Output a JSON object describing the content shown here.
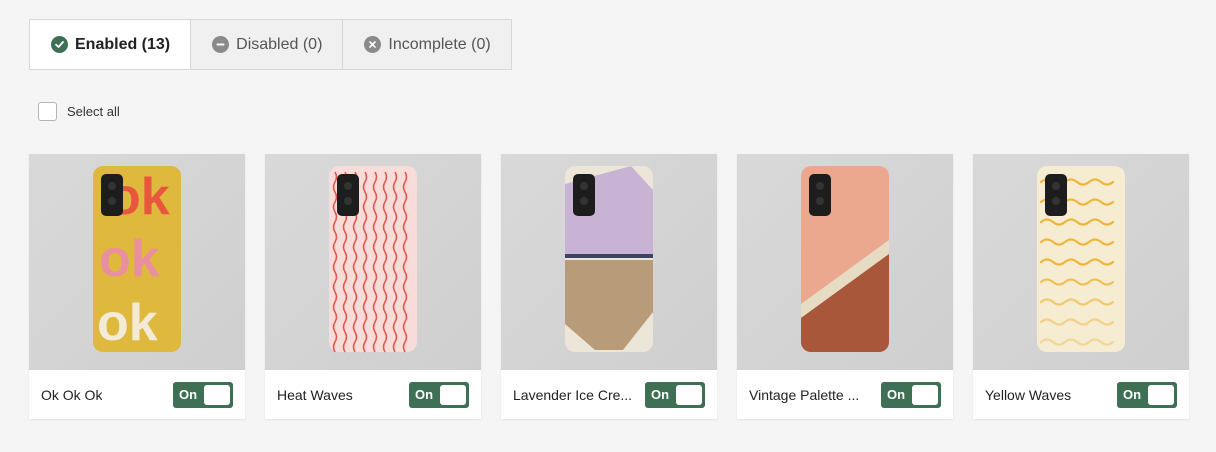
{
  "tabs": [
    {
      "label": "Enabled (13)",
      "icon": "check-circle-icon",
      "color": "#3e7055",
      "active": true
    },
    {
      "label": "Disabled (0)",
      "icon": "minus-circle-icon",
      "color": "#8a8a8a",
      "active": false
    },
    {
      "label": "Incomplete (0)",
      "icon": "x-circle-icon",
      "color": "#8a8a8a",
      "active": false
    }
  ],
  "select_all": {
    "label": "Select all"
  },
  "products": [
    {
      "title": "Ok Ok Ok",
      "toggle_label": "On",
      "enabled": true
    },
    {
      "title": "Heat Waves",
      "toggle_label": "On",
      "enabled": true
    },
    {
      "title": "Lavender Ice Cre...",
      "toggle_label": "On",
      "enabled": true
    },
    {
      "title": "Vintage Palette ...",
      "toggle_label": "On",
      "enabled": true
    },
    {
      "title": "Yellow Waves",
      "toggle_label": "On",
      "enabled": true
    }
  ],
  "colors": {
    "accent": "#3e7055",
    "background": "#f5f5f5"
  }
}
